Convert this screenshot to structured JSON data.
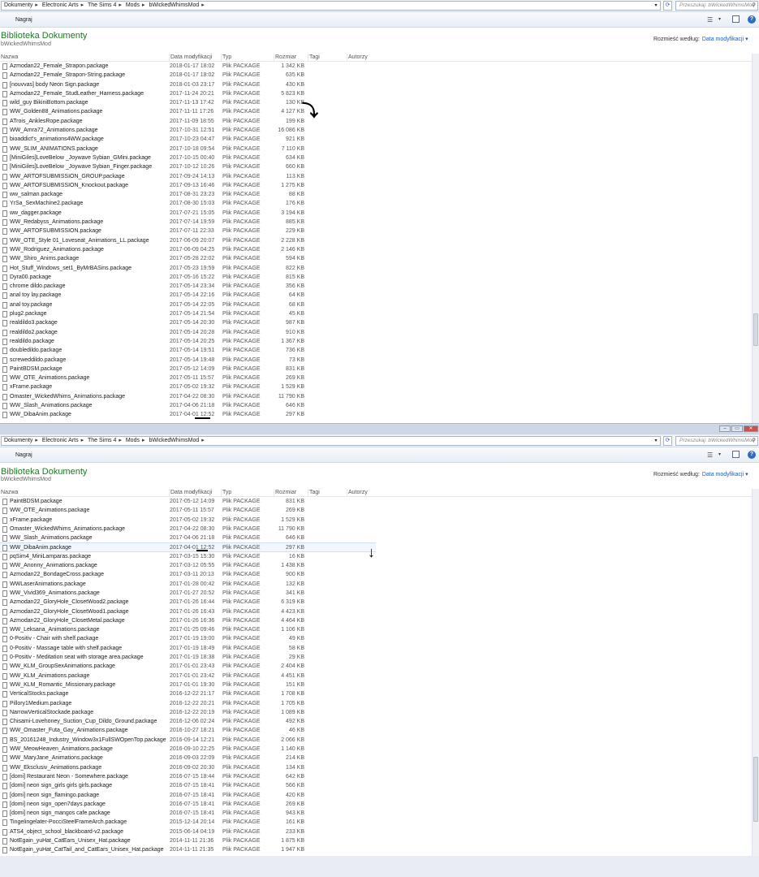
{
  "address": {
    "crumbs": [
      "Dokumenty",
      "Electronic Arts",
      "The Sims 4",
      "Mods",
      "bWickedWhimsMod"
    ],
    "separator": "▸",
    "search_placeholder": "Przeszukaj: bWickedWhimsMod"
  },
  "toolbar": {
    "burn_label": "Nagraj"
  },
  "library": {
    "title": "Biblioteka Dokumenty",
    "subtitle": "bWickedWhimsMod",
    "arrange_label": "Rozmieść według:",
    "arrange_value": "Data modyfikacji ▾"
  },
  "columns": {
    "name": "Nazwa",
    "date": "Data modyfikacji",
    "type": "Typ",
    "size": "Rozmiar",
    "tags": "Tagi",
    "authors": "Autorzy"
  },
  "window1_files": [
    {
      "name": "Azmodan22_Female_Strapon.package",
      "date": "2018-01-17 18:02",
      "type": "Plik PACKAGE",
      "size": "1 342 KB"
    },
    {
      "name": "Azmodan22_Female_Strapon-String.package",
      "date": "2018-01-17 18:02",
      "type": "Plik PACKAGE",
      "size": "635 KB"
    },
    {
      "name": "[nouvvas] body Neon Sign.package",
      "date": "2018-01-03 23:17",
      "type": "Plik PACKAGE",
      "size": "430 KB"
    },
    {
      "name": "Azmodan22_Female_StudLeather_Harness.package",
      "date": "2017-11-24 20:21",
      "type": "Plik PACKAGE",
      "size": "5 823 KB"
    },
    {
      "name": "wild_guy BikiniBottom.package",
      "date": "2017-11-13 17:42",
      "type": "Plik PACKAGE",
      "size": "130 KB"
    },
    {
      "name": "WW_Golden88_Animations.package",
      "date": "2017-11-11 17:26",
      "type": "Plik PACKAGE",
      "size": "4 127 KB"
    },
    {
      "name": "ATrois_AnklesRope.package",
      "date": "2017-11-09 18:55",
      "type": "Plik PACKAGE",
      "size": "199 KB"
    },
    {
      "name": "WW_Amra72_Animations.package",
      "date": "2017-10-31 12:51",
      "type": "Plik PACKAGE",
      "size": "16 086 KB"
    },
    {
      "name": "bioaddict's_animations4WW.package",
      "date": "2017-10-23 04:47",
      "type": "Plik PACKAGE",
      "size": "921 KB"
    },
    {
      "name": "WW_SLIM_ANIMATIONS.package",
      "date": "2017-10-18 09:54",
      "type": "Plik PACKAGE",
      "size": "7 110 KB"
    },
    {
      "name": "[MiniGiles]LoveBelow _Joywave Sybian_GMini.package",
      "date": "2017-10-15 00:40",
      "type": "Plik PACKAGE",
      "size": "634 KB"
    },
    {
      "name": "[MiniGiles]LoveBelow _Joywave Sybian_Finger.package",
      "date": "2017-10-12 10:26",
      "type": "Plik PACKAGE",
      "size": "660 KB"
    },
    {
      "name": "WW_ARTOFSUBMISSION_GROUP.package",
      "date": "2017-09-24 14:13",
      "type": "Plik PACKAGE",
      "size": "113 KB"
    },
    {
      "name": "WW_ARTOFSUBMISSION_Knockout.package",
      "date": "2017-09-13 16:46",
      "type": "Plik PACKAGE",
      "size": "1 275 KB"
    },
    {
      "name": "ww_salman.package",
      "date": "2017-08-31 23:23",
      "type": "Plik PACKAGE",
      "size": "88 KB"
    },
    {
      "name": "YrSa_SexMachine2.package",
      "date": "2017-08-30 15:03",
      "type": "Plik PACKAGE",
      "size": "176 KB"
    },
    {
      "name": "ww_dagger.package",
      "date": "2017-07-21 15:05",
      "type": "Plik PACKAGE",
      "size": "3 194 KB"
    },
    {
      "name": "WW_Redabyss_Animations.package",
      "date": "2017-07-14 19:59",
      "type": "Plik PACKAGE",
      "size": "885 KB"
    },
    {
      "name": "WW_ARTOFSUBMISSION.package",
      "date": "2017-07-11 22:33",
      "type": "Plik PACKAGE",
      "size": "229 KB"
    },
    {
      "name": "WW_OTE_Style 01_Loveseat_Animations_LL.package",
      "date": "2017-06-09 20:07",
      "type": "Plik PACKAGE",
      "size": "2 228 KB"
    },
    {
      "name": "WW_Rodriguez_Animations.package",
      "date": "2017-06-09 04:25",
      "type": "Plik PACKAGE",
      "size": "2 146 KB"
    },
    {
      "name": "WW_Shiro_Anims.package",
      "date": "2017-05-28 22:02",
      "type": "Plik PACKAGE",
      "size": "594 KB"
    },
    {
      "name": "Hot_Stuff_Windows_set1_ByMrBASins.package",
      "date": "2017-05-23 19:59",
      "type": "Plik PACKAGE",
      "size": "822 KB"
    },
    {
      "name": "Dyra00.package",
      "date": "2017-05-16 15:22",
      "type": "Plik PACKAGE",
      "size": "815 KB"
    },
    {
      "name": "chrome dildo.package",
      "date": "2017-05-14 23:34",
      "type": "Plik PACKAGE",
      "size": "356 KB"
    },
    {
      "name": "anal toy lay.package",
      "date": "2017-05-14 22:16",
      "type": "Plik PACKAGE",
      "size": "64 KB"
    },
    {
      "name": "anal toy.package",
      "date": "2017-05-14 22:05",
      "type": "Plik PACKAGE",
      "size": "68 KB"
    },
    {
      "name": "plug2.package",
      "date": "2017-05-14 21:54",
      "type": "Plik PACKAGE",
      "size": "45 KB"
    },
    {
      "name": "realdildo3.package",
      "date": "2017-05-14 20:30",
      "type": "Plik PACKAGE",
      "size": "987 KB"
    },
    {
      "name": "realdildo2.package",
      "date": "2017-05-14 20:28",
      "type": "Plik PACKAGE",
      "size": "910 KB"
    },
    {
      "name": "realdildo.package",
      "date": "2017-05-14 20:25",
      "type": "Plik PACKAGE",
      "size": "1 367 KB"
    },
    {
      "name": "doubledildo.package",
      "date": "2017-05-14 19:51",
      "type": "Plik PACKAGE",
      "size": "736 KB"
    },
    {
      "name": "screweddildo.package",
      "date": "2017-05-14 19:48",
      "type": "Plik PACKAGE",
      "size": "73 KB"
    },
    {
      "name": "PaintBDSM.package",
      "date": "2017-05-12 14:09",
      "type": "Plik PACKAGE",
      "size": "831 KB"
    },
    {
      "name": "WW_OTE_Animations.package",
      "date": "2017-05-11 15:57",
      "type": "Plik PACKAGE",
      "size": "269 KB"
    },
    {
      "name": "xFrame.package",
      "date": "2017-05-02 19:32",
      "type": "Plik PACKAGE",
      "size": "1 529 KB"
    },
    {
      "name": "Omaster_WickedWhims_Animations.package",
      "date": "2017-04-22 08:30",
      "type": "Plik PACKAGE",
      "size": "11 790 KB"
    },
    {
      "name": "WW_Slash_Animations.package",
      "date": "2017-04-06 21:18",
      "type": "Plik PACKAGE",
      "size": "646 KB"
    },
    {
      "name": "WW_DibaAnim.package",
      "date": "2017-04-01 12:52",
      "type": "Plik PACKAGE",
      "size": "297 KB"
    }
  ],
  "window2_files": [
    {
      "name": "PaintBDSM.package",
      "date": "2017-05-12 14:09",
      "type": "Plik PACKAGE",
      "size": "831 KB"
    },
    {
      "name": "WW_OTE_Animations.package",
      "date": "2017-05-11 15:57",
      "type": "Plik PACKAGE",
      "size": "269 KB"
    },
    {
      "name": "xFrame.package",
      "date": "2017-05-02 19:32",
      "type": "Plik PACKAGE",
      "size": "1 529 KB"
    },
    {
      "name": "Omaster_WickedWhims_Animations.package",
      "date": "2017-04-22 08:30",
      "type": "Plik PACKAGE",
      "size": "11 790 KB"
    },
    {
      "name": "WW_Slash_Animations.package",
      "date": "2017-04-06 21:18",
      "type": "Plik PACKAGE",
      "size": "646 KB"
    },
    {
      "name": "WW_DibaAnim.package",
      "date": "2017-04-01 12:52",
      "type": "Plik PACKAGE",
      "size": "297 KB"
    },
    {
      "name": "pqSim4_MiniLamparas.package",
      "date": "2017-03-15 15:30",
      "type": "Plik PACKAGE",
      "size": "16 KB"
    },
    {
      "name": "WW_Anonny_Animations.package",
      "date": "2017-03-12 05:55",
      "type": "Plik PACKAGE",
      "size": "1 438 KB"
    },
    {
      "name": "Azmodan22_BondageCross.package",
      "date": "2017-03-11 20:13",
      "type": "Plik PACKAGE",
      "size": "900 KB"
    },
    {
      "name": "WWLaserAnimations.package",
      "date": "2017-01-28 00:42",
      "type": "Plik PACKAGE",
      "size": "132 KB"
    },
    {
      "name": "WW_Vivid369_Animations.package",
      "date": "2017-01-27 20:52",
      "type": "Plik PACKAGE",
      "size": "341 KB"
    },
    {
      "name": "Azmodan22_GloryHole_ClosetWood2.package",
      "date": "2017-01-26 16:44",
      "type": "Plik PACKAGE",
      "size": "6 319 KB"
    },
    {
      "name": "Azmodan22_GloryHole_ClosetWood1.package",
      "date": "2017-01-26 16:43",
      "type": "Plik PACKAGE",
      "size": "4 423 KB"
    },
    {
      "name": "Azmodan22_GloryHole_ClosetMetal.package",
      "date": "2017-01-26 16:36",
      "type": "Plik PACKAGE",
      "size": "4 464 KB"
    },
    {
      "name": "WW_Leksana_Animations.package",
      "date": "2017-01-25 09:46",
      "type": "Plik PACKAGE",
      "size": "1 106 KB"
    },
    {
      "name": "0-Positiv - Chair with shelf.package",
      "date": "2017-01-19 19:00",
      "type": "Plik PACKAGE",
      "size": "49 KB"
    },
    {
      "name": "0-Positiv - Massage table with shelf.package",
      "date": "2017-01-19 18:49",
      "type": "Plik PACKAGE",
      "size": "58 KB"
    },
    {
      "name": "0-Positiv - Meditation seat with storage area.package",
      "date": "2017-01-19 18:38",
      "type": "Plik PACKAGE",
      "size": "29 KB"
    },
    {
      "name": "WW_KLM_GroupSexAnimations.package",
      "date": "2017-01-01 23:43",
      "type": "Plik PACKAGE",
      "size": "2 404 KB"
    },
    {
      "name": "WW_KLM_Animations.package",
      "date": "2017-01-01 23:42",
      "type": "Plik PACKAGE",
      "size": "4 451 KB"
    },
    {
      "name": "WW_KLM_Romantic_Missionary.package",
      "date": "2017-01-01 19:30",
      "type": "Plik PACKAGE",
      "size": "151 KB"
    },
    {
      "name": "VerticalStocks.package",
      "date": "2016-12-22 21:17",
      "type": "Plik PACKAGE",
      "size": "1 708 KB"
    },
    {
      "name": "Pillory1Medium.package",
      "date": "2016-12-22 20:21",
      "type": "Plik PACKAGE",
      "size": "1 705 KB"
    },
    {
      "name": "NarrowVerticalStockade.package",
      "date": "2016-12-22 20:19",
      "type": "Plik PACKAGE",
      "size": "1 089 KB"
    },
    {
      "name": "Chisami-Lovehoney_Suction_Cup_Dildo_Ground.package",
      "date": "2016-12-06 02:24",
      "type": "Plik PACKAGE",
      "size": "492 KB"
    },
    {
      "name": "WW_Omaster_Futa_Gay_Animations.package",
      "date": "2016-10-27 18:21",
      "type": "Plik PACKAGE",
      "size": "46 KB"
    },
    {
      "name": "BS_20161248_Industry_Window3x1FullSWOpenTop.package",
      "date": "2016-09-14 12:21",
      "type": "Plik PACKAGE",
      "size": "2 066 KB"
    },
    {
      "name": "WW_MeowHeaven_Animations.package",
      "date": "2016-09-10 22:25",
      "type": "Plik PACKAGE",
      "size": "1 140 KB"
    },
    {
      "name": "WW_MaryJane_Animations.package",
      "date": "2016-09-03 22:09",
      "type": "Plik PACKAGE",
      "size": "214 KB"
    },
    {
      "name": "WW_Eksclusiv_Animations.package",
      "date": "2016-09-02 20:30",
      "type": "Plik PACKAGE",
      "size": "134 KB"
    },
    {
      "name": "[domi] Restaurant Neon - Somewhere.package",
      "date": "2016-07-15 18:44",
      "type": "Plik PACKAGE",
      "size": "642 KB"
    },
    {
      "name": "[domi] neon sign_girls girls girls.package",
      "date": "2016-07-15 18:41",
      "type": "Plik PACKAGE",
      "size": "566 KB"
    },
    {
      "name": "[domi] neon sign_flamingo.package",
      "date": "2016-07-15 18:41",
      "type": "Plik PACKAGE",
      "size": "420 KB"
    },
    {
      "name": "[domi] neon sign_open7days.package",
      "date": "2016-07-15 18:41",
      "type": "Plik PACKAGE",
      "size": "269 KB"
    },
    {
      "name": "[domi] neon sign_mangos cafe.package",
      "date": "2016-07-15 18:41",
      "type": "Plik PACKAGE",
      "size": "943 KB"
    },
    {
      "name": "Tingelingelater-PocciSteelFrameArch.package",
      "date": "2015-12-14 20:14",
      "type": "Plik PACKAGE",
      "size": "161 KB"
    },
    {
      "name": "ATS4_object_school_blackboard-v2.package",
      "date": "2015-06-14 04:19",
      "type": "Plik PACKAGE",
      "size": "233 KB"
    },
    {
      "name": "NotEgain_yuHat_CatEars_Unisex_Hat.package",
      "date": "2014-11-11 21:36",
      "type": "Plik PACKAGE",
      "size": "1 875 KB"
    },
    {
      "name": "NotEgain_yuHat_CatTail_and_CatEars_Unisex_Hat.package",
      "date": "2014-11-11 21:35",
      "type": "Plik PACKAGE",
      "size": "1 947 KB"
    }
  ],
  "window2_selected_index": 5,
  "window_controls": [
    "–",
    "▭",
    "✕"
  ],
  "annotations": {
    "arrow1": "⤵",
    "arrow2": "↓"
  }
}
